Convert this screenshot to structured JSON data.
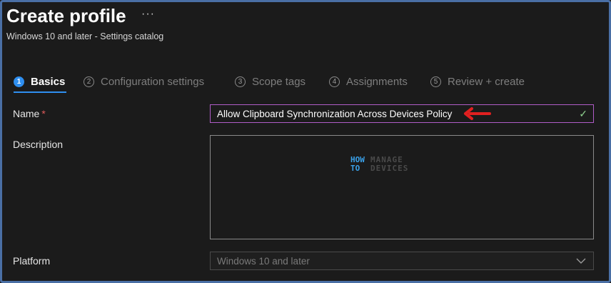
{
  "header": {
    "title": "Create profile",
    "more_label": "···",
    "subtitle": "Windows 10 and later - Settings catalog"
  },
  "tabs": [
    {
      "num": "1",
      "label": "Basics",
      "active": true
    },
    {
      "num": "2",
      "label": "Configuration settings",
      "active": false
    },
    {
      "num": "3",
      "label": "Scope tags",
      "active": false
    },
    {
      "num": "4",
      "label": "Assignments",
      "active": false
    },
    {
      "num": "5",
      "label": "Review + create",
      "active": false
    }
  ],
  "form": {
    "name_label": "Name",
    "required_mark": "*",
    "name_value": "Allow Clipboard Synchronization Across Devices Policy",
    "description_label": "Description",
    "description_value": "",
    "platform_label": "Platform",
    "platform_value": "Windows 10 and later"
  },
  "watermark": {
    "line1_left": "HOW",
    "line2_left": "TO",
    "line1_right": "MANAGE",
    "line2_right": "DEVICES"
  },
  "colors": {
    "accent": "#2f8ff0",
    "name_border": "#b05cc8",
    "annotation_arrow": "#e02020",
    "required": "#e05a5a",
    "valid_check": "#8fd38f"
  },
  "icons": {
    "more": "ellipsis-icon",
    "valid": "checkmark-icon",
    "dropdown": "chevron-down-icon",
    "annotation": "red-arrow-icon"
  }
}
